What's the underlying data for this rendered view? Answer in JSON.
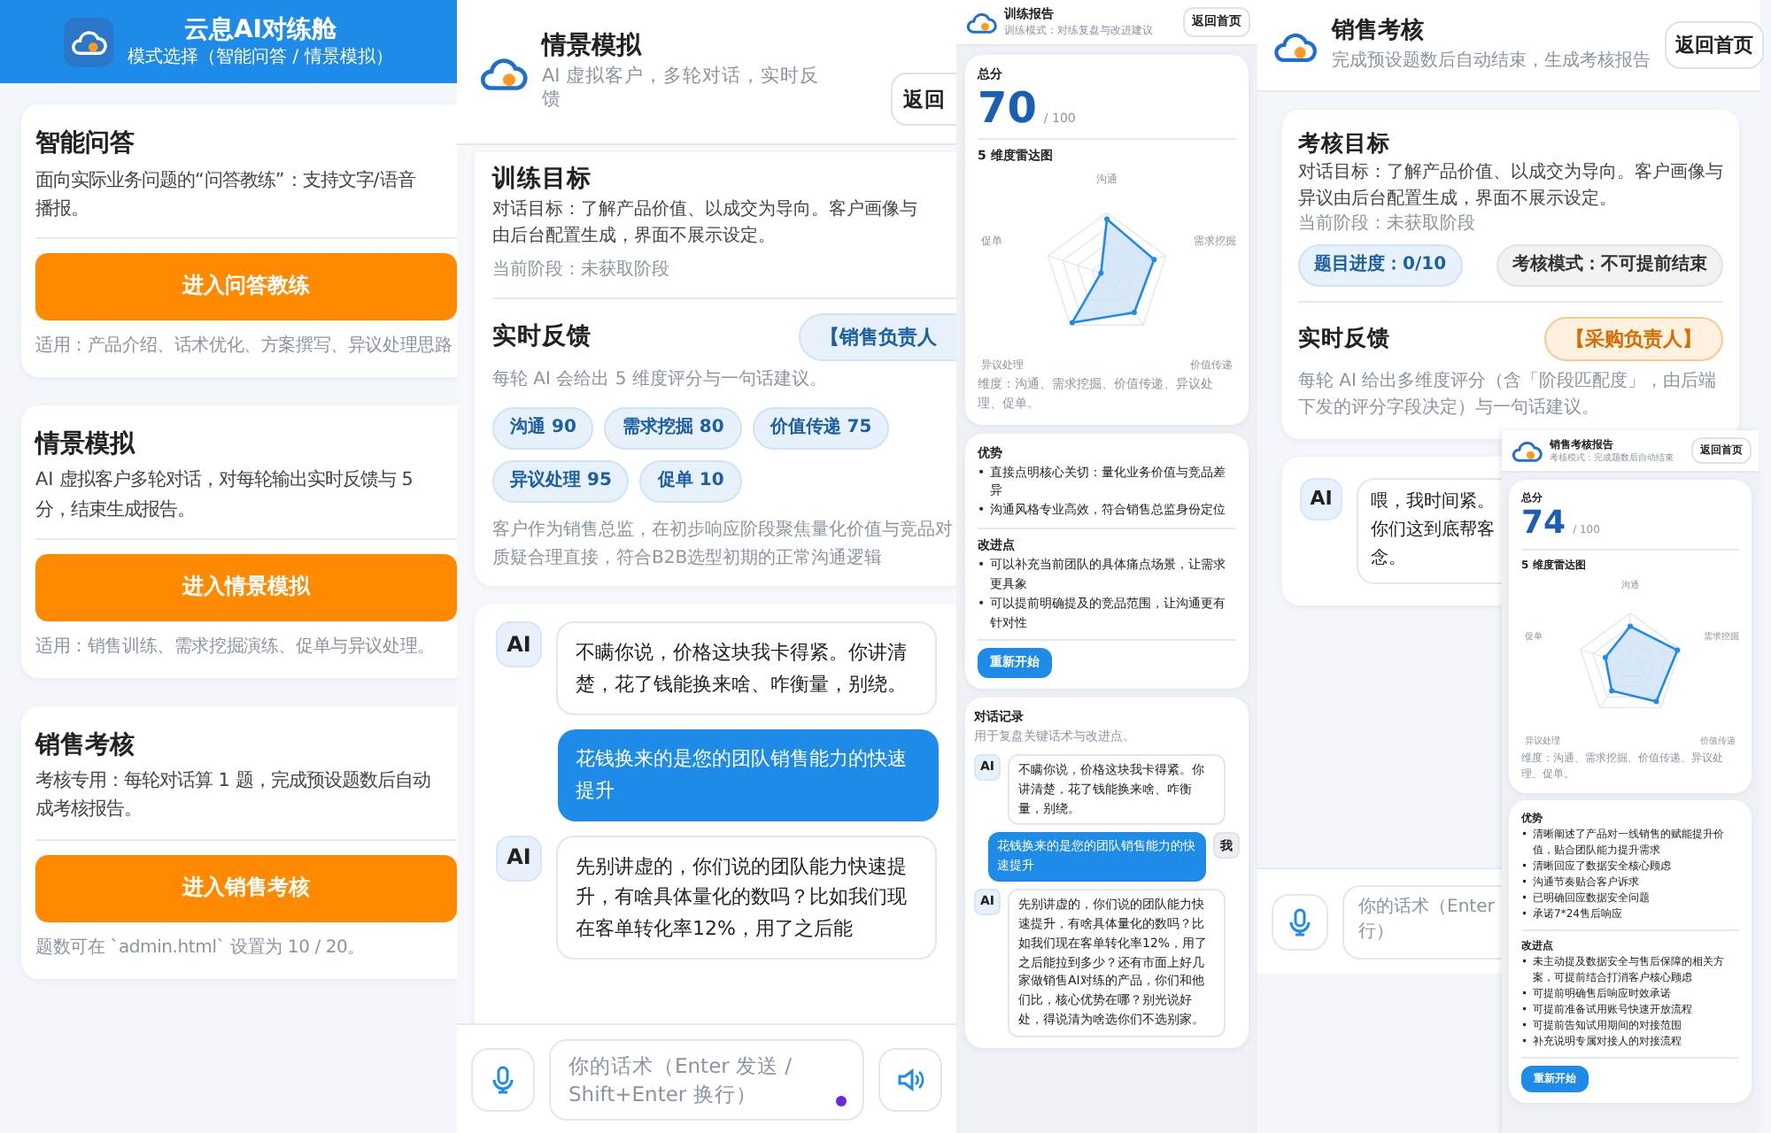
{
  "home": {
    "title": "云息AI对练舱",
    "subtitle": "模式选择（智能问答 / 情景模拟）",
    "modes": [
      {
        "title": "智能问答",
        "desc": [
          "面向实际业务问题的“问答教练”：支持文字/语音",
          "播报。"
        ],
        "button": "进入问答教练",
        "note": "适用：产品介绍、话术优化、方案撰写、异议处理思路"
      },
      {
        "title": "情景模拟",
        "desc": [
          "AI 虚拟客户多轮对话，对每轮输出实时反馈与 5",
          "分，结束生成报告。"
        ],
        "button": "进入情景模拟",
        "note": "适用：销售训练、需求挖掘演练、促单与异议处理。"
      },
      {
        "title": "销售考核",
        "desc": [
          "考核专用：每轮对话算 1 题，完成预设题数后自动",
          "成考核报告。"
        ],
        "button": "进入销售考核",
        "note": "题数可在 `admin.html` 设置为 10 / 20。"
      }
    ]
  },
  "simulation": {
    "title": "情景模拟",
    "subtitle": [
      "AI 虚拟客户，多轮对话，实时反",
      "馈"
    ],
    "back_button": "返回",
    "goal": {
      "title": "训练目标",
      "desc": [
        "对话目标：了解产品价值、以成交为导向。客户画像与",
        "由后台配置生成，界面不展示设定。"
      ],
      "stage": "当前阶段：未获取阶段"
    },
    "feedback": {
      "title": "实时反馈",
      "role": "【销售负责人",
      "hint": "每轮 AI 会给出 5 维度评分与一句话建议。",
      "scores": [
        "沟通 90",
        "需求挖掘 80",
        "价值传递 75",
        "异议处理 95",
        "促单 10"
      ],
      "comment": [
        "客户作为销售总监，在初步响应阶段聚焦量化价值与竞品对",
        "质疑合理直接，符合B2B选型初期的正常沟通逻辑"
      ]
    },
    "messages": [
      {
        "kind": "ai",
        "avatar": "AI",
        "text": "不瞒你说，价格这块我卡得紧。你讲清楚，花了钱能换来啥、咋衡量，别绕。"
      },
      {
        "kind": "user",
        "text": "花钱换来的是您的团队销售能力的快速提升"
      },
      {
        "kind": "ai",
        "avatar": "AI",
        "text": "先别讲虚的，你们说的团队能力快速提升，有啥具体量化的数吗？比如我们现在客单转化率12%，用了之后能"
      }
    ],
    "input": {
      "placeholder": "你的话术（Enter 发送 / Shift+Enter 换行）"
    }
  },
  "training_report": {
    "title": "训练报告",
    "subtitle": "训练模式：对练复盘与改进建议",
    "back_button": "返回首页",
    "score_label": "总分",
    "score": "70",
    "score_max": "/ 100",
    "radar_title": "5 维度雷达图",
    "axes": [
      "沟通",
      "需求挖掘",
      "价值传递",
      "异议处理",
      "促单"
    ],
    "radar_note": "维度：沟通、需求挖掘、价值传递、异议处理、促单。",
    "bullet": "•",
    "strengths_title": "优势",
    "strengths": [
      "直接点明核心关切：量化业务价值与竞品差异",
      "沟通风格专业高效，符合销售总监身份定位"
    ],
    "improvements_title": "改进点",
    "improvements": [
      "可以补充当前团队的具体痛点场景，让需求更具象",
      "可以提前明确提及的竞品范围，让沟通更有针对性"
    ],
    "restart_button": "重新开始",
    "log_title": "对话记录",
    "log_hint": "用于复盘关键话术与改进点。",
    "messages": [
      {
        "kind": "ai",
        "avatar": "AI",
        "text": "不瞒你说，价格这块我卡得紧。你讲清楚，花了钱能换来啥、咋衡量，别绕。"
      },
      {
        "kind": "user",
        "avatar": "我",
        "text": "花钱换来的是您的团队销售能力的快速提升"
      },
      {
        "kind": "ai",
        "avatar": "AI",
        "text": "先别讲虚的，你们说的团队能力快速提升，有啥具体量化的数吗？比如我们现在客单转化率12%，用了之后能拉到多少？还有市面上好几家做销售AI对练的产品，你们和他们比，核心优势在哪？别光说好处，得说清为啥选你们不选别家。"
      }
    ]
  },
  "exam": {
    "title": "销售考核",
    "subtitle": "完成预设题数后自动结束，生成考核报告",
    "back_button": "返回首页",
    "goal": {
      "title": "考核目标",
      "desc": "对话目标：了解产品价值、以成交为导向。客户画像与异议由后台配置生成，界面不展示设定。",
      "stage": "当前阶段：未获取阶段",
      "progress": "题目进度：0/10",
      "mode": "考核模式：不可提前结束"
    },
    "feedback": {
      "title": "实时反馈",
      "role": "【采购负责人】",
      "hint": "每轮 AI 给出多维度评分（含「阶段匹配度」，由后端下发的评分字段决定）与一句话建议。"
    },
    "messages": [
      {
        "kind": "ai",
        "avatar": "AI",
        "lines": [
          "喂，我时间紧。",
          "你们这到底帮客",
          "念。"
        ]
      }
    ],
    "input": {
      "placeholder": [
        "你的话术（Enter",
        "行）"
      ]
    }
  },
  "exam_report": {
    "title": "销售考核报告",
    "subtitle": "考核模式：完成题数后自动结束",
    "back_button": "返回首页",
    "score_label": "总分",
    "score": "74",
    "score_max": "/ 100",
    "radar_title": "5 维度雷达图",
    "axes": [
      "沟通",
      "需求挖掘",
      "价值传递",
      "异议处理",
      "促单"
    ],
    "radar_note": "维度：沟通、需求挖掘、价值传递、异议处理、促单。",
    "bullet": "•",
    "strengths_title": "优势",
    "strengths": [
      "清晰阐述了产品对一线销售的赋能提升价值，贴合团队能力提升需求",
      "清晰回应了数据安全核心顾虑",
      "沟通节奏贴合客户诉求",
      "已明确回应数据安全问题",
      "承诺7*24售后响应"
    ],
    "improvements_title": "改进点",
    "improvements": [
      "未主动提及数据安全与售后保障的相关方案，可提前结合打消客户核心顾虑",
      "可提前明确售后响应时效承诺",
      "可提前准备试用账号快速开放流程",
      "可提前告知试用期间的对接范围",
      "补充说明专属对接人的对接流程"
    ],
    "restart_button": "重新开始"
  }
}
